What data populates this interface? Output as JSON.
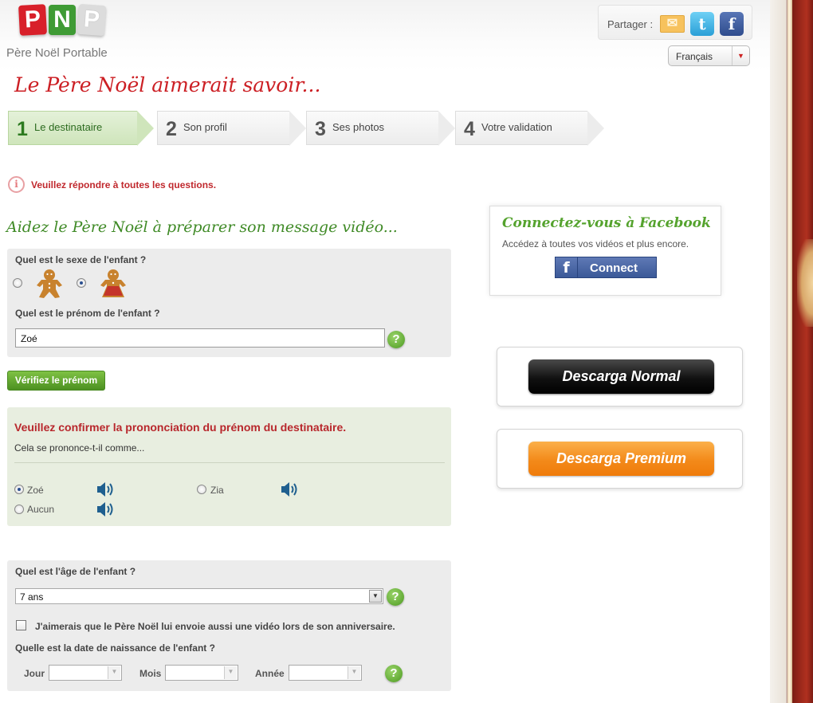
{
  "brand": {
    "logo_letters": [
      "P",
      "N",
      "P"
    ],
    "tagline": "Père Noël Portable"
  },
  "share": {
    "label": "Partager :",
    "icons": [
      "mail-icon",
      "twitter-icon",
      "facebook-icon"
    ]
  },
  "language": {
    "selected": "Français"
  },
  "page_title": "Le Père Noël aimerait savoir...",
  "steps": [
    {
      "num": "1",
      "label": "Le destinataire",
      "active": true
    },
    {
      "num": "2",
      "label": "Son profil",
      "active": false
    },
    {
      "num": "3",
      "label": "Ses photos",
      "active": false
    },
    {
      "num": "4",
      "label": "Votre validation",
      "active": false
    }
  ],
  "warning": "Veuillez répondre à toutes les questions.",
  "section_title": "Aidez le Père Noël à préparer son message vidéo...",
  "gender": {
    "question": "Quel est le sexe de l'enfant ?",
    "selected": "girl"
  },
  "name": {
    "question": "Quel est le prénom de l'enfant ?",
    "value": "Zoé",
    "help": "?"
  },
  "verify_button": "Vérifiez le prénom",
  "pronunciation": {
    "heading": "Veuillez confirmer la prononciation du prénom du destinataire.",
    "subheading": "Cela se prononce-t-il comme...",
    "options": [
      {
        "label": "Zoé",
        "selected": true
      },
      {
        "label": "Zia",
        "selected": false
      },
      {
        "label": "Aucun",
        "selected": false
      }
    ]
  },
  "age": {
    "question": "Quel est l'âge de l'enfant ?",
    "value": "7 ans",
    "birthday_checkbox": "J'aimerais que le Père Noël lui envoie aussi une vidéo lors de son anniversaire.",
    "birthday_checked": false,
    "dob_question": "Quelle est la date de naissance de l'enfant ?",
    "day_label": "Jour",
    "month_label": "Mois",
    "year_label": "Année"
  },
  "facebook": {
    "title": "Connectez-vous à Facebook",
    "description": "Accédez à toutes vos vidéos et plus encore.",
    "button": "Connect",
    "button_icon": "f"
  },
  "downloads": {
    "normal": "Descarga Normal",
    "premium": "Descarga Premium"
  },
  "colors": {
    "accent_red": "#cc1f24",
    "accent_green": "#3f8a26",
    "facebook_blue": "#3b5998",
    "premium_orange": "#f38a1a"
  }
}
